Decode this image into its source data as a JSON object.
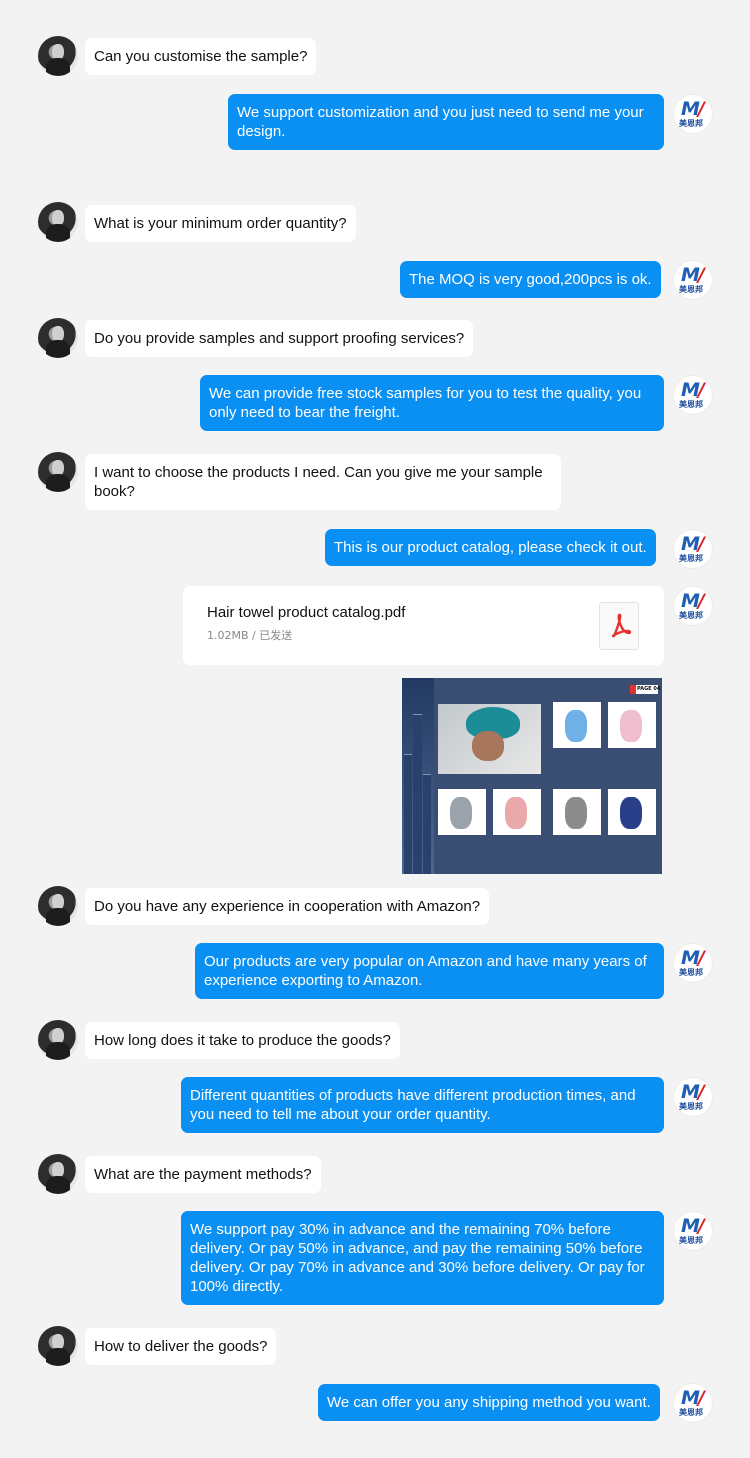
{
  "messages": [
    {
      "from": "user",
      "lines": [
        "Can you customise the sample?"
      ]
    },
    {
      "from": "brand",
      "lines": [
        "We support customization and you just need to send me your",
        "design."
      ]
    },
    {
      "from": "user",
      "lines": [
        "What is your minimum order quantity?"
      ]
    },
    {
      "from": "brand",
      "lines": [
        "The MOQ is very good,200pcs is ok."
      ]
    },
    {
      "from": "user",
      "lines": [
        "Do you provide samples and support proofing services?"
      ]
    },
    {
      "from": "brand",
      "lines": [
        "We can provide free stock samples for you to test the quality, you",
        "only need to bear the freight."
      ]
    },
    {
      "from": "user",
      "lines": [
        "I want to choose the products I need. Can you give me your sample",
        "book?"
      ]
    },
    {
      "from": "brand",
      "lines": [
        "This is our product catalog, please check it out."
      ]
    },
    {
      "from": "user",
      "lines": [
        "Do you have any experience in cooperation with Amazon?"
      ]
    },
    {
      "from": "brand",
      "lines": [
        "Our products are very popular on Amazon and have many years of",
        "experience exporting to Amazon."
      ]
    },
    {
      "from": "user",
      "lines": [
        "How long does it take to produce the goods?"
      ]
    },
    {
      "from": "brand",
      "lines": [
        "Different quantities of products have different production times, and",
        "you need to tell me about your order quantity."
      ]
    },
    {
      "from": "user",
      "lines": [
        "What are the payment methods?"
      ]
    },
    {
      "from": "brand",
      "lines": [
        "We support pay 30% in advance and the remaining 70% before",
        "delivery. Or pay 50% in advance, and pay the remaining 50% before",
        "delivery. Or pay 70% in advance and 30% before delivery. Or pay for",
        "100% directly."
      ]
    },
    {
      "from": "user",
      "lines": [
        "How to deliver the goods?"
      ]
    },
    {
      "from": "brand",
      "lines": [
        "We can offer you any shipping method you want."
      ]
    }
  ],
  "file_attachment": {
    "name": "Hair towel product catalog.pdf",
    "meta": "1.02MB / 已发送",
    "icon": "pdf-icon"
  },
  "catalog_image": {
    "page_label": "PAGE 04"
  },
  "brand_avatar": {
    "logo_letter": "M",
    "text": "美恩邦"
  },
  "colors": {
    "background": "#f3f3f3",
    "outgoing_bubble": "#0a8ff2",
    "incoming_bubble": "#ffffff"
  }
}
